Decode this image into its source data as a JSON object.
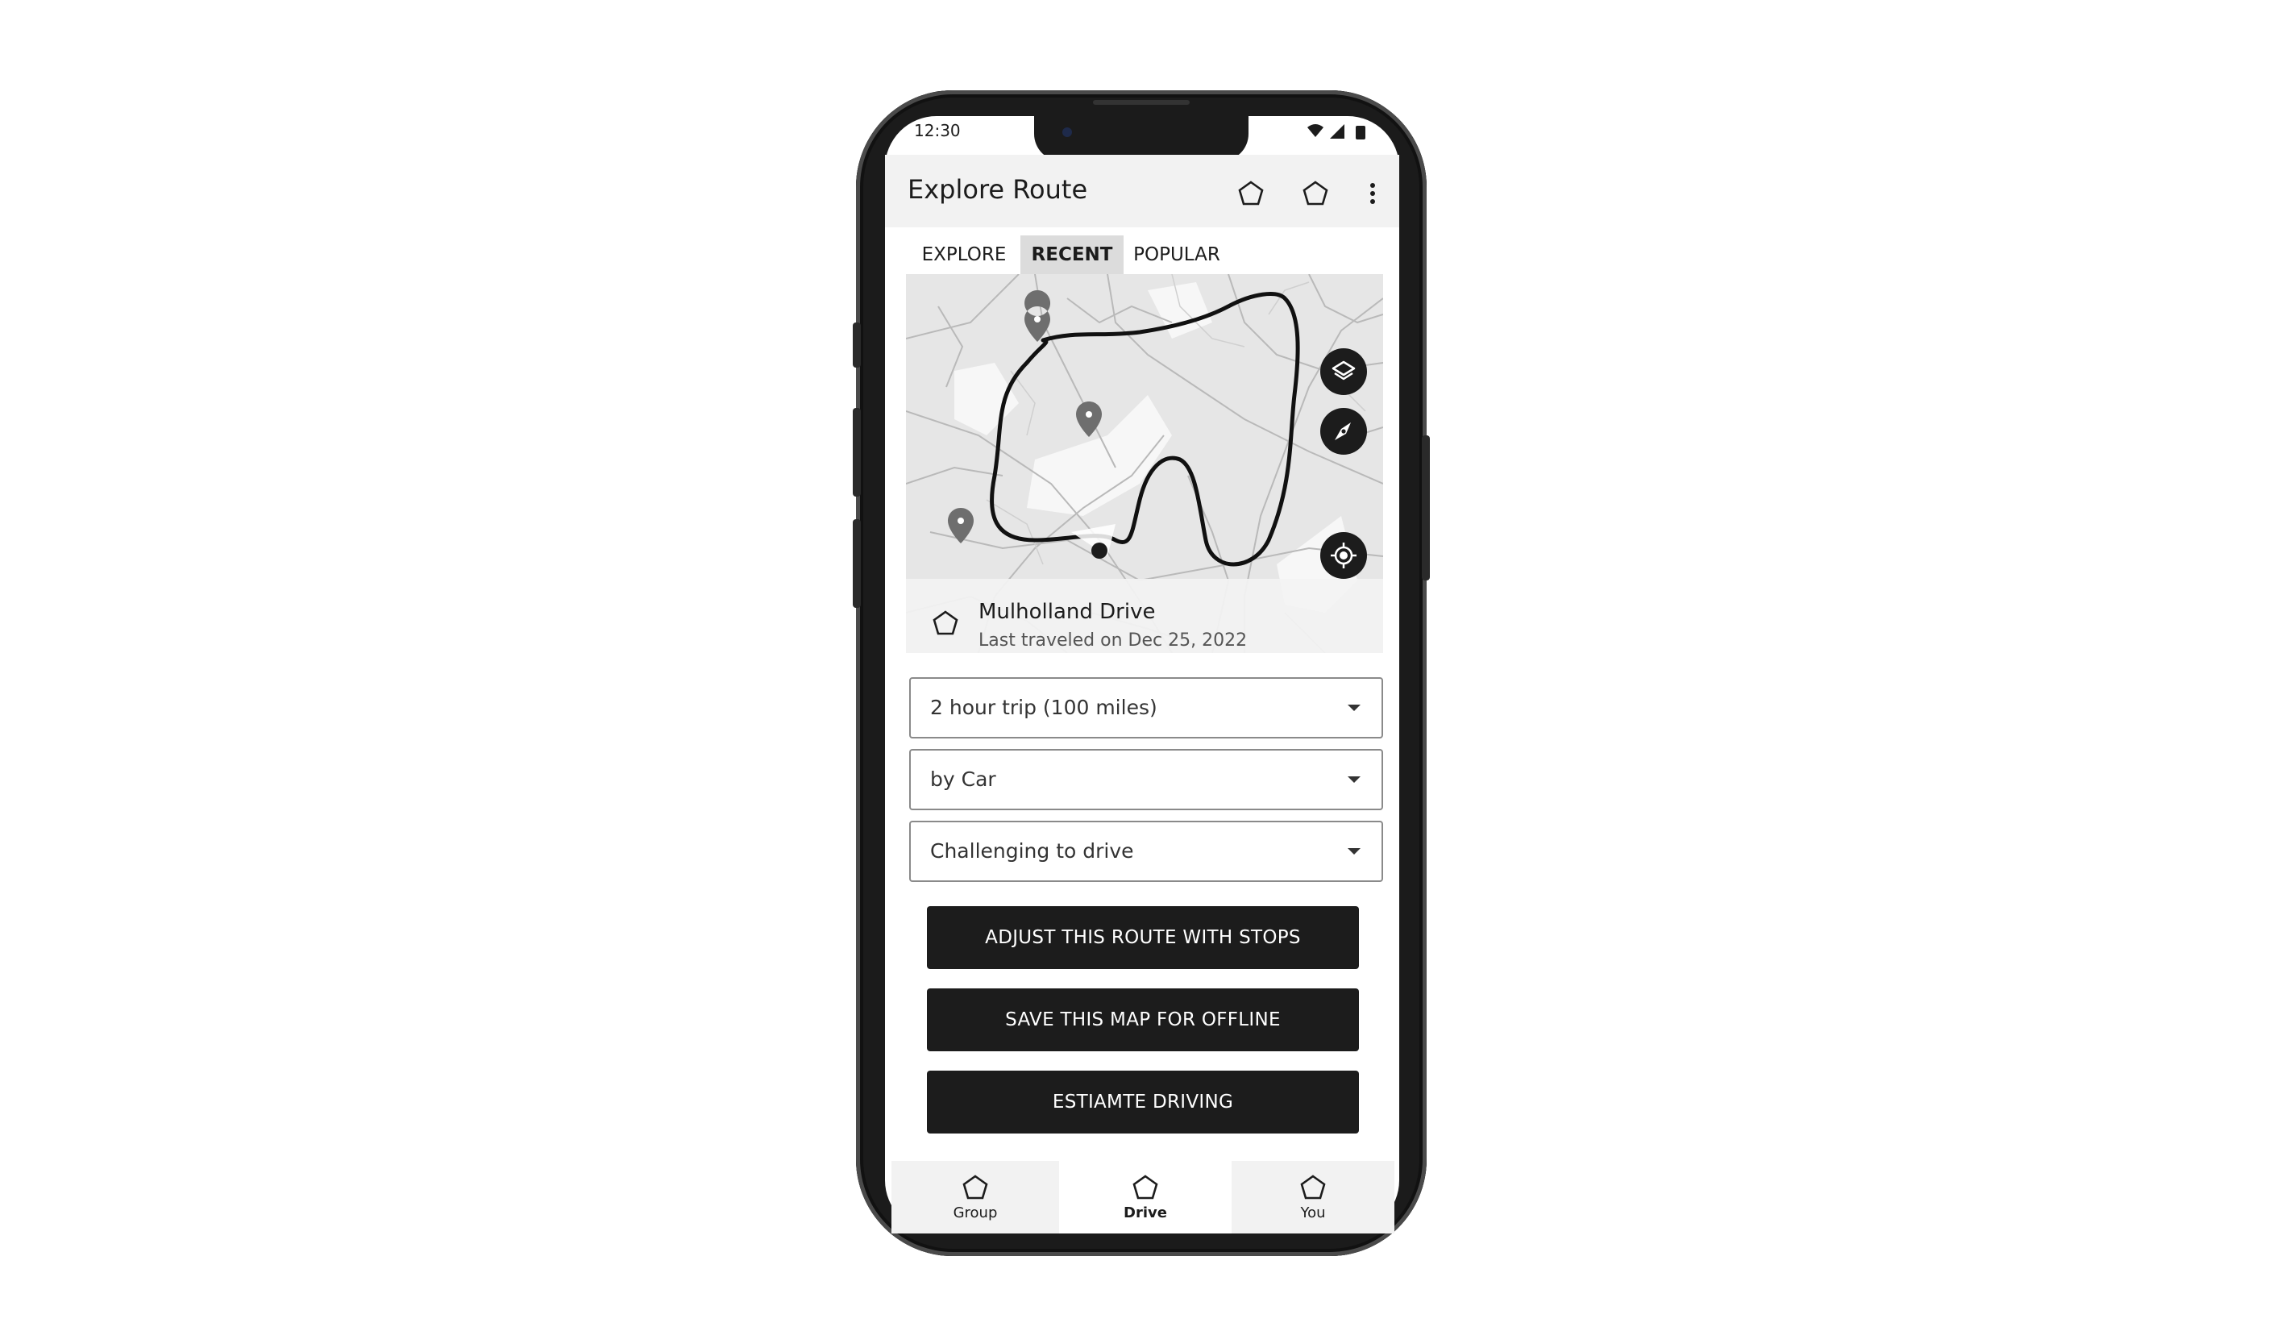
{
  "status_bar": {
    "time": "12:30"
  },
  "app_bar": {
    "title": "Explore Route",
    "actions": [
      "pentagon-icon",
      "pentagon-icon",
      "more-vert-icon"
    ]
  },
  "tabs": [
    {
      "label": "EXPLORE",
      "selected": false
    },
    {
      "label": "RECENT",
      "selected": true
    },
    {
      "label": "POPULAR",
      "selected": false
    }
  ],
  "map": {
    "controls": [
      "layers-icon",
      "compass-icon",
      "my-location-icon"
    ],
    "route": {
      "name": "Mulholland Drive",
      "subtitle": "Last traveled on Dec 25, 2022",
      "icon": "pentagon-icon"
    }
  },
  "selects": [
    {
      "value": "2 hour trip (100 miles)"
    },
    {
      "value": "by Car"
    },
    {
      "value": "Challenging to drive"
    }
  ],
  "buttons": [
    {
      "label": "ADJUST THIS ROUTE WITH STOPS"
    },
    {
      "label": "SAVE THIS MAP FOR OFFLINE"
    },
    {
      "label": "ESTIAMTE DRIVING"
    }
  ],
  "bottom_nav": [
    {
      "label": "Group",
      "icon": "pentagon-icon",
      "selected": false
    },
    {
      "label": "Drive",
      "icon": "pentagon-icon",
      "selected": true
    },
    {
      "label": "You",
      "icon": "pentagon-icon",
      "selected": false
    }
  ],
  "colors": {
    "primary": "#1c1c1c",
    "surface": "#f2f2f2",
    "map_bg": "#e6e6e6",
    "selected_tab": "#dcdcdc"
  }
}
